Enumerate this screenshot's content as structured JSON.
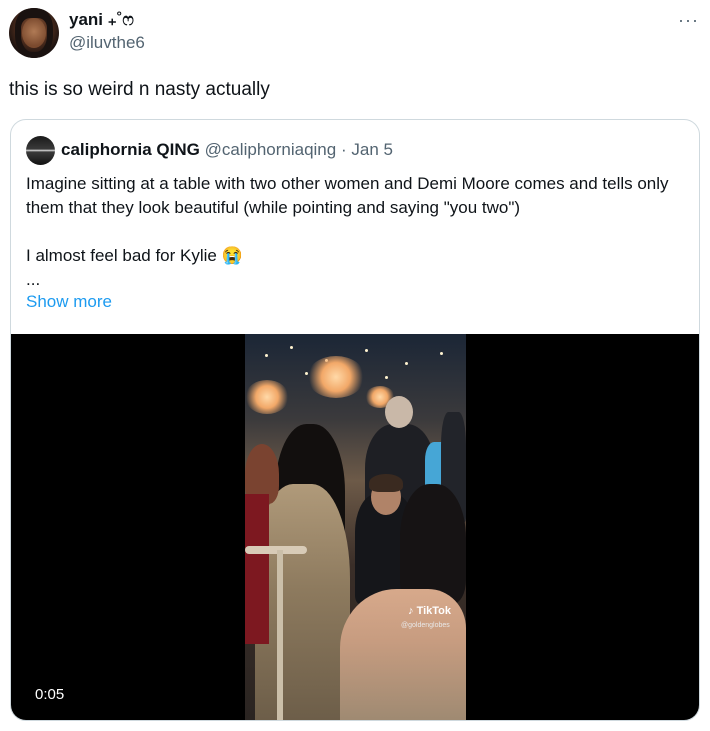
{
  "author": {
    "display_name": "yani ₊˚ෆ",
    "handle": "@iluvthe6",
    "avatar_icon": "profile-photo-avatar",
    "more_icon": "more-options-icon",
    "more_glyph": "···"
  },
  "tweet": {
    "text": "this is so weird n nasty actually"
  },
  "quoted": {
    "avatar_icon": "quoted-profile-avatar",
    "display_name": "caliphornia QING",
    "handle": "@caliphorniaqing",
    "separator": "·",
    "date": "Jan 5",
    "body_line1": "Imagine sitting at a table with two other women and Demi Moore comes and tells only them that they look beautiful (while pointing and saying \"you two\")",
    "body_line2": "I almost feel bad for Kylie 😭",
    "body_line3": "...",
    "show_more": "Show more"
  },
  "media": {
    "watermark_brand": "TikTok",
    "watermark_handle": "@goldenglobes",
    "duration": "0:05",
    "background": "#000000"
  },
  "colors": {
    "text": "#0f1419",
    "secondary": "#536471",
    "link": "#1d9bf0",
    "border": "#cfd9de"
  }
}
